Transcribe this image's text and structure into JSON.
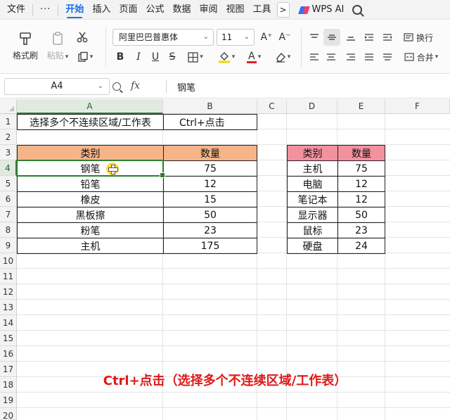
{
  "menubar": {
    "items": [
      "文件",
      "开始",
      "插入",
      "页面",
      "公式",
      "数据",
      "审阅",
      "视图",
      "工具"
    ],
    "active": "开始",
    "more": ">",
    "ai_label": "WPS AI"
  },
  "ribbon": {
    "format_painter": "格式刷",
    "paste": "粘贴",
    "font_name": "阿里巴巴普惠体",
    "font_size": "11",
    "font_increase": "A⁺",
    "font_decrease": "A⁻",
    "bold": "B",
    "italic": "I",
    "underline": "U",
    "strike": "S",
    "wrap": "换行",
    "merge": "合并",
    "font_color": "#e02020",
    "fill_color": "#f6d400"
  },
  "formula_bar": {
    "name_box": "A4",
    "fx": "fx",
    "content": "钢笔"
  },
  "grid": {
    "columns": [
      "A",
      "B",
      "C",
      "D",
      "E",
      "F"
    ],
    "rows": [
      "1",
      "2",
      "3",
      "4",
      "5",
      "6",
      "7",
      "8",
      "9",
      "10",
      "11",
      "12",
      "13",
      "14",
      "15",
      "16",
      "17",
      "18",
      "19",
      "20"
    ],
    "row1": {
      "a": "选择多个不连续区域/工作表",
      "b": "Ctrl+点击"
    },
    "table1": {
      "header": [
        "类别",
        "数量"
      ],
      "rows": [
        [
          "钢笔",
          "75"
        ],
        [
          "铅笔",
          "12"
        ],
        [
          "橡皮",
          "15"
        ],
        [
          "黑板擦",
          "50"
        ],
        [
          "粉笔",
          "23"
        ],
        [
          "主机",
          "175"
        ]
      ],
      "header_color": "#f6b489"
    },
    "table2": {
      "header": [
        "类别",
        "数量"
      ],
      "rows": [
        [
          "主机",
          "75"
        ],
        [
          "电脑",
          "12"
        ],
        [
          "笔记本",
          "12"
        ],
        [
          "显示器",
          "50"
        ],
        [
          "鼠标",
          "23"
        ],
        [
          "硬盘",
          "24"
        ]
      ],
      "header_color": "#f3919e"
    },
    "selected_cell": "A4"
  },
  "caption": "Ctrl+点击（选择多个不连续区域/工作表）"
}
